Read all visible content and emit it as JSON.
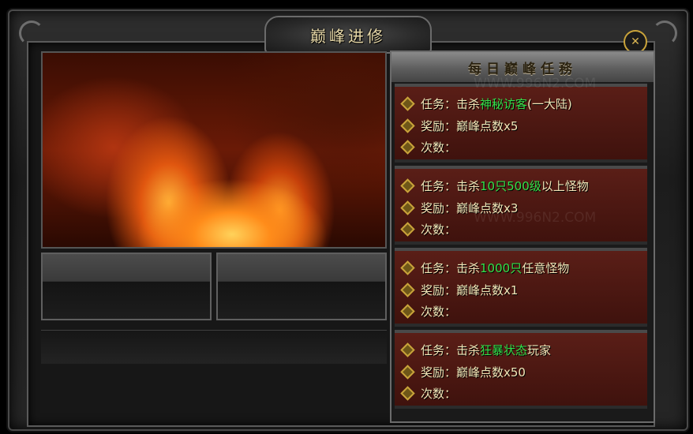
{
  "window": {
    "title": "巅峰进修",
    "close_label": "✕"
  },
  "watermark": "WWW.996N2.COM",
  "task_panel": {
    "title": "每日巅峰任務",
    "tasks": [
      {
        "task_prefix": "任务：击杀",
        "task_highlight": "神秘访客",
        "task_suffix": "(一大陆)",
        "reward": "奖励：巅峰点数x5",
        "count": "次数："
      },
      {
        "task_prefix": "任务：击杀",
        "task_highlight": "10只500级",
        "task_suffix": "以上怪物",
        "reward": "奖励：巅峰点数x3",
        "count": "次数："
      },
      {
        "task_prefix": "任务：击杀",
        "task_highlight": "1000只",
        "task_suffix": "任意怪物",
        "reward": "奖励：巅峰点数x1",
        "count": "次数："
      },
      {
        "task_prefix": "任务：击杀",
        "task_highlight": "狂暴状态",
        "task_suffix": "玩家",
        "reward": "奖励：巅峰点数x50",
        "count": "次数："
      }
    ]
  },
  "colors": {
    "highlight": "#33e04a",
    "text": "#f2e6b8",
    "gold": "#c9a33a"
  }
}
